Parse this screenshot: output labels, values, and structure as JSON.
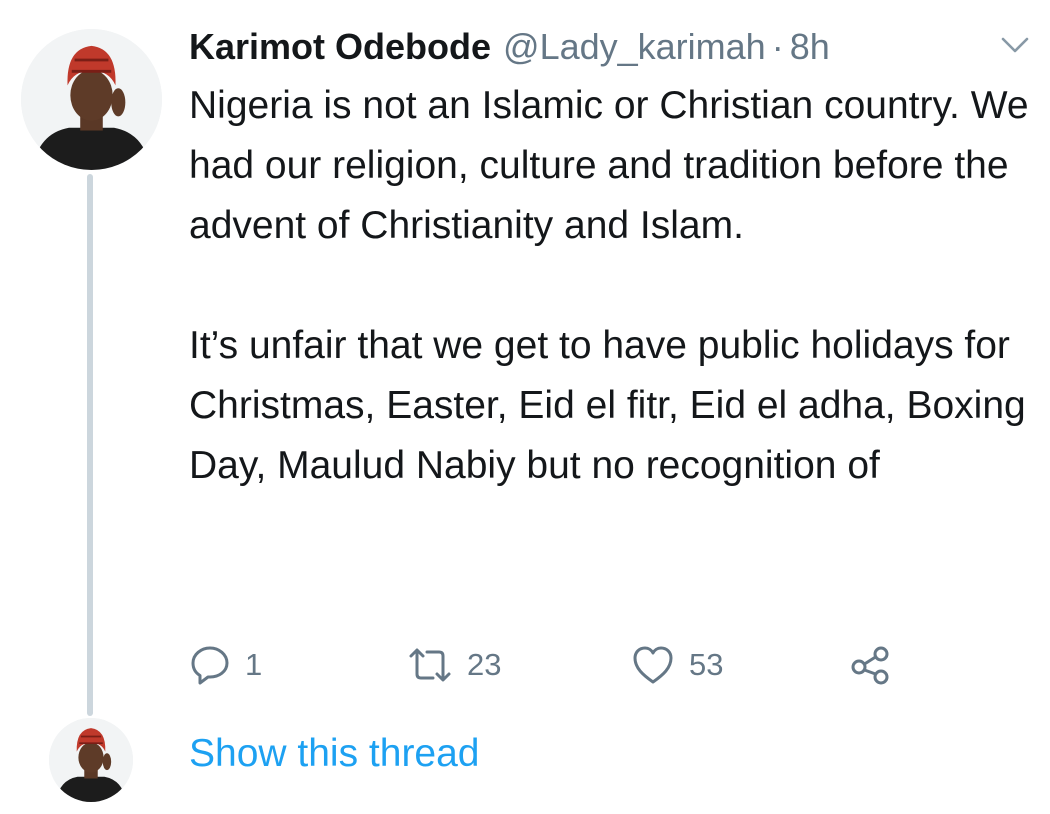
{
  "tweet": {
    "author_name": "Karimot Odebode",
    "handle": "@Lady_karimah",
    "separator": "·",
    "time": "8h",
    "paragraphs": [
      "Nigeria is not an Islamic or Christian country. We had our religion, culture and tradition before the advent of Christianity and Islam.",
      "It’s unfair that we get to have public holidays for Christmas, Easter, Eid el fitr, Eid el adha, Boxing Day, Maulud Nabiy but no recognition of"
    ]
  },
  "actions": {
    "reply": {
      "icon": "reply-icon",
      "count": "1"
    },
    "retweet": {
      "icon": "retweet-icon",
      "count": "23"
    },
    "like": {
      "icon": "heart-icon",
      "count": "53"
    },
    "share": {
      "icon": "share-icon"
    }
  },
  "thread_link": "Show this thread",
  "colors": {
    "text": "#14171a",
    "secondary": "#657786",
    "link": "#1da1f2",
    "thread_line": "#ccd6dd",
    "background": "#ffffff"
  }
}
